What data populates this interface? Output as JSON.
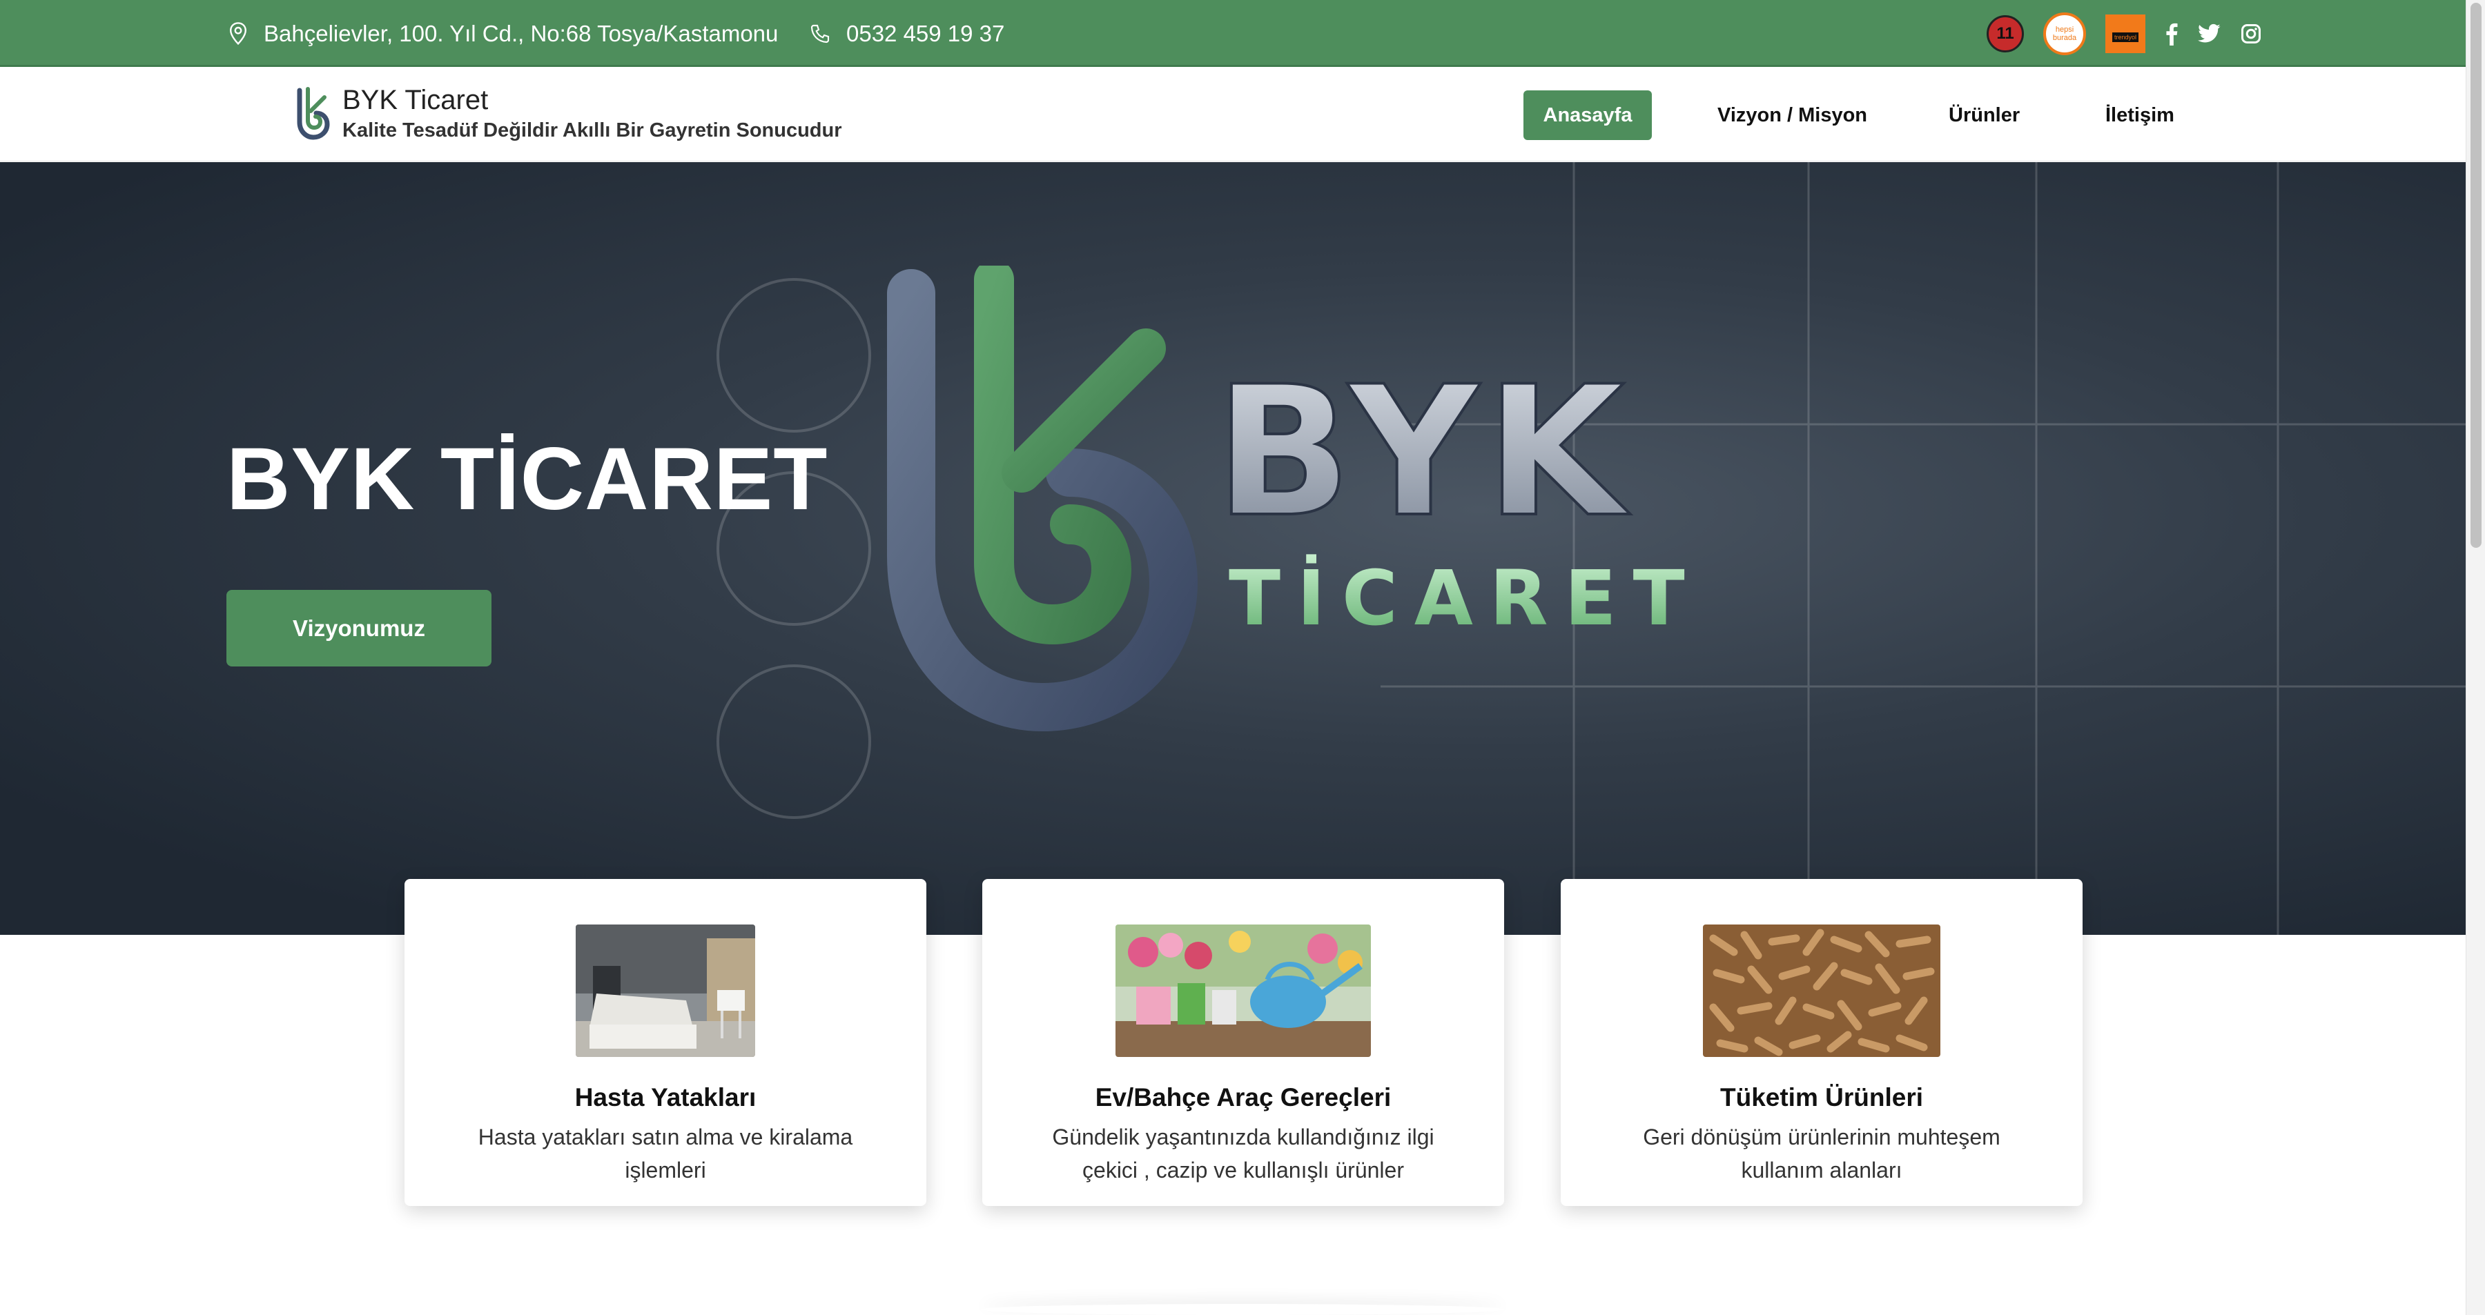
{
  "topbar": {
    "address": "Bahçelievler, 100. Yıl Cd., No:68 Tosya/Kastamonu",
    "phone": "0532 459 19 37",
    "icons": [
      "location-pin-icon",
      "phone-icon",
      "n11-icon",
      "hepsiburada-icon",
      "trendyol-icon",
      "facebook-icon",
      "twitter-icon",
      "instagram-icon"
    ],
    "n11": "11",
    "hepsiburada": "hepsi burada",
    "trendyol": "trendyol"
  },
  "brand": {
    "title": "BYK Ticaret",
    "subtitle": "Kalite Tesadüf Değildir Akıllı Bir Gayretin Sonucudur"
  },
  "nav": {
    "items": [
      "Anasayfa",
      "Vizyon / Misyon",
      "Ürünler",
      "İletişim"
    ],
    "active": "Anasayfa"
  },
  "hero": {
    "title": "BYK TİCARET",
    "button": "Vizyonumuz",
    "logo_text_top": "BYK",
    "logo_text_bottom": "TİCARET"
  },
  "cards": [
    {
      "title": "Hasta Yatakları",
      "text": "Hasta yatakları satın alma ve kiralama işlemleri"
    },
    {
      "title": "Ev/Bahçe Araç Gereçleri",
      "text": "Gündelik yaşantınızda kullandığınız ilgi çekici , cazip ve kullanışlı ürünler"
    },
    {
      "title": "Tüketim Ürünleri",
      "text": "Geri dönüşüm ürünlerinin muhteşem kullanım alanları"
    }
  ],
  "colors": {
    "primary_green": "#4e8e5c",
    "hero_dark": "#2a333e",
    "white": "#ffffff"
  }
}
